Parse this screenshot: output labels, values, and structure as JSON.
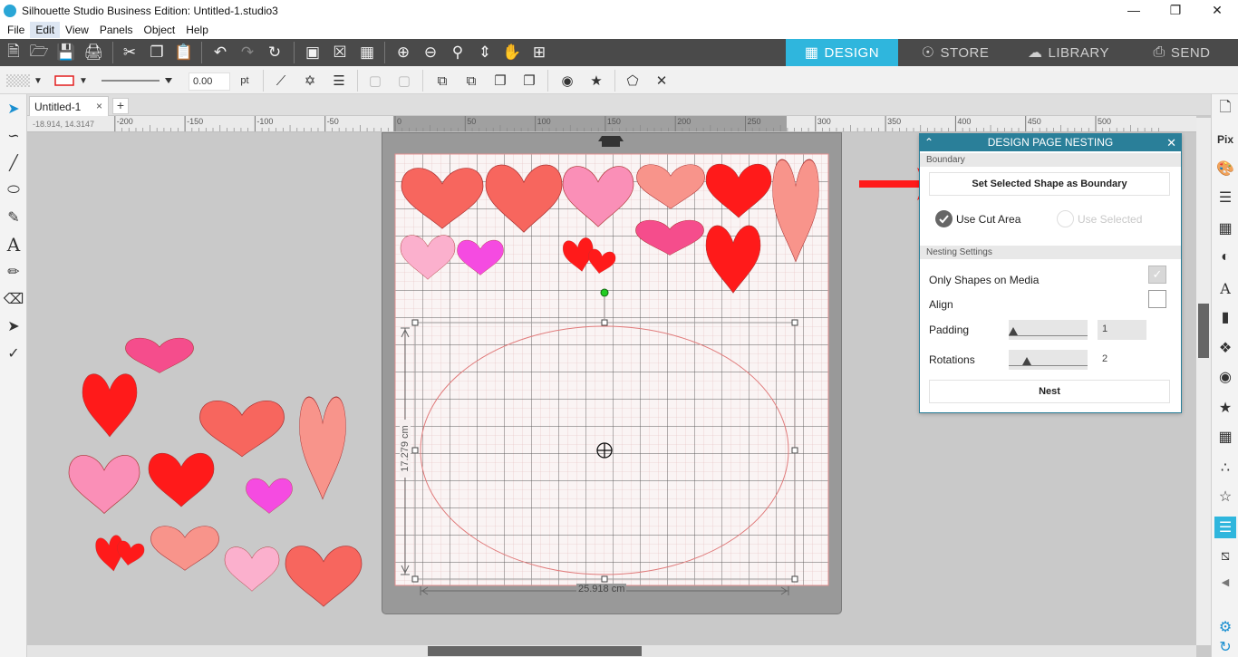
{
  "window": {
    "title": "Silhouette Studio Business Edition: Untitled-1.studio3"
  },
  "menu": [
    "File",
    "Edit",
    "View",
    "Panels",
    "Object",
    "Help"
  ],
  "nav_tabs": [
    {
      "label": "DESIGN",
      "icon": "design-icon"
    },
    {
      "label": "STORE",
      "icon": "store-icon"
    },
    {
      "label": "LIBRARY",
      "icon": "library-icon"
    },
    {
      "label": "SEND",
      "icon": "send-icon"
    }
  ],
  "toolbar2": {
    "line_width_value": "0.00",
    "line_width_unit": "pt"
  },
  "document_tab": {
    "name": "Untitled-1",
    "close": "×",
    "add": "+"
  },
  "ruler": {
    "coordinates": "-18.914, 14.3147",
    "labels": [
      "-200",
      "-150",
      "-100",
      "-50",
      "0",
      "50",
      "100",
      "150",
      "200",
      "250",
      "300",
      "350",
      "400",
      "450",
      "500"
    ]
  },
  "canvas": {
    "width_dimension": "25.918 cm",
    "height_dimension": "17.279 cm",
    "selection_shape": "ellipse"
  },
  "nesting_panel": {
    "title": "DESIGN PAGE NESTING",
    "boundary_section": "Boundary",
    "set_boundary_button": "Set Selected Shape as Boundary",
    "use_cut_area": "Use Cut Area",
    "use_cut_area_selected": true,
    "use_selected": "Use Selected",
    "use_selected_enabled": false,
    "settings_section": "Nesting Settings",
    "only_shapes_on_media": "Only Shapes on Media",
    "only_shapes_on_media_checked": true,
    "align": "Align",
    "align_checked": false,
    "padding_label": "Padding",
    "padding_value": "1",
    "rotations_label": "Rotations",
    "rotations_value": "2",
    "nest_button": "Nest"
  },
  "colors": {
    "accent": "#2fb6dd",
    "panel_header": "#2a7f99",
    "arrow": "#ff1a1a",
    "heart_coral": "#f7665e",
    "heart_pink": "#fa8fb7",
    "heart_red": "#ff1a1a",
    "heart_magenta": "#f54be1",
    "heart_hotpink": "#f54d8c",
    "heart_salmon": "#f8948b",
    "heart_lightpink": "#fbb0cd"
  }
}
